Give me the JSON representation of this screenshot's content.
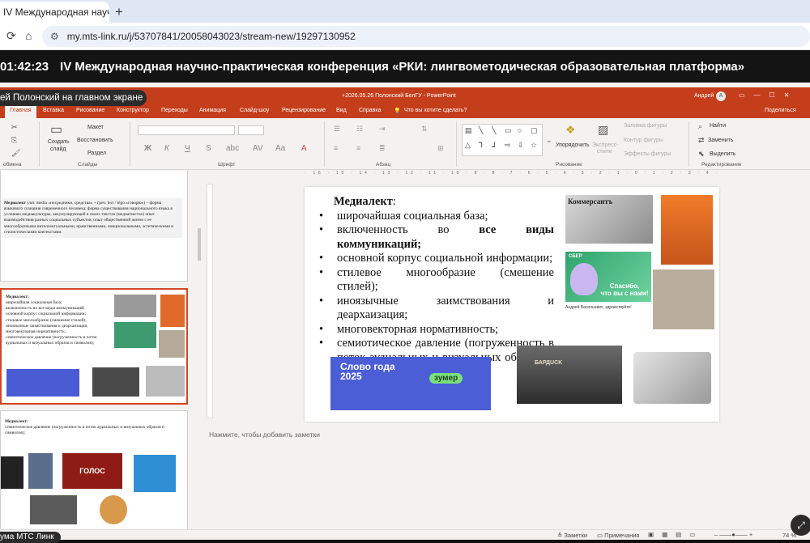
{
  "browser": {
    "tab_title": "IV Международная научно",
    "url": "my.mts-link.ru/j/53707841/20058043023/stream-new/19297130952"
  },
  "stream": {
    "timer": "01:42:23",
    "title": "IV Международная научно-практическая конференция «РКИ: лингвометодическая образовательная платформа»",
    "presenter_label": "ей Полонский на главном экране",
    "bottom_label": "ума МТС Линк"
  },
  "powerpoint": {
    "filename": "+2026.05.26 Полонский БелГУ  -  PowerPoint",
    "user": "Андрей",
    "user_initial": "А",
    "ribbon_tabs": [
      "Главная",
      "Вставка",
      "Рисование",
      "Конструктор",
      "Переходы",
      "Анимация",
      "Слайд-шоу",
      "Рецензирование",
      "Вид",
      "Справка"
    ],
    "tell_me": "Что вы хотите сделать?",
    "share": "Поделиться",
    "groups": {
      "clipboard": "обмена",
      "slides": "Слайды",
      "font": "Шрифт",
      "paragraph": "Абзац",
      "drawing": "Рисование",
      "editing": "Редактирование"
    },
    "commands": {
      "create_slide_1": "Создать",
      "create_slide_2": "слайд",
      "layout": "Макет",
      "reset": "Восстановить",
      "section": "Раздел",
      "arrange": "Упорядочить",
      "express_1": "Экспресс-",
      "express_2": "стили",
      "fill": "Заливка фигуры",
      "outline": "Контур фигуры",
      "effects": "Эффекты фигуры",
      "find": "Найти",
      "replace": "Заменить",
      "select": "Выделить"
    },
    "ruler_top": "· 16 · 15 · 14 · 13 · 12 · 11 · 10 · 9 · 8 · 7 · 6 · 5 · 4 · 3 · 2 · 1 · 0 · 1 · 2 · 3 · 4 · 5 · 6 · 7 · 8 · 9 · 10 · 11 · 12 · 13 · 14 · 15 · 16",
    "notes_placeholder": "Нажмите, чтобы добавить заметки",
    "status": {
      "notes": "Заметки",
      "comments": "Примечания",
      "zoom": "74 %"
    }
  },
  "slide": {
    "title": "Медиалект",
    "title_suffix": ":",
    "bullets": [
      {
        "text": "широчайшая социальная база;"
      },
      {
        "prefix": "включенность во ",
        "bold": "все виды коммуникаций;"
      },
      {
        "text": "основной корпус социальной информации;"
      },
      {
        "text": "стилевое многообразие (смешение стилей);"
      },
      {
        "text": "иноязычные заимствования и деархаизация;"
      },
      {
        "text": "многовекторная нормативность;"
      },
      {
        "text": "семиотическое давление (погруженность в поток аудиальных и визуальных образов и символов);"
      }
    ],
    "images": {
      "newspapers": "Коммерсантъ",
      "sber_text_1": "Спасибо,",
      "sber_text_2": "что вы с нами!",
      "sber_logo": "СБЕР",
      "article_heading": "Андрей Васильевич, здравствуйте!",
      "word_of_year_1": "Слово года",
      "word_of_year_2": "2025",
      "zoomer": "зумер",
      "barbershop": "БАРДUCK"
    }
  },
  "thumbnails": {
    "slide1_title": "Медиалект",
    "slide1_text": "(лат. media «посредники, средства» + греч. lect / légo «говорю») – форма языкового сознания современного человека; форма существования национального языка в условиях медиакультуры, аккумулирующей в своих текстах (медиатекстах) опыт взаимодействия разных социальных субъектов, опыт общественной жизни с ее многообразными интеллектуальными, нравственными, эмоциональными, эстетическими и стилистическими контекстами.",
    "slide2_title": "Медиалект",
    "slide2_lines": [
      "широчайшая социальная база;",
      "включенность во все виды коммуникаций;",
      "основной корпус социальной информации;",
      "стилевое многообразие (смешение стилей);",
      "иноязычные заимствования и деархаизация;",
      "многовекторная нормативность;",
      "семиотическое давление (погруженность в поток аудиальных и визуальных образов и символов);"
    ],
    "slide3_title": "Медиалект",
    "slide3_text": "семиотическое давление (погруженность в поток аудиальных и визуальных образов и символов);",
    "slide3_show": "ГОЛОС"
  },
  "colors": {
    "accent": "#c43e1c",
    "dark": "#141414"
  }
}
